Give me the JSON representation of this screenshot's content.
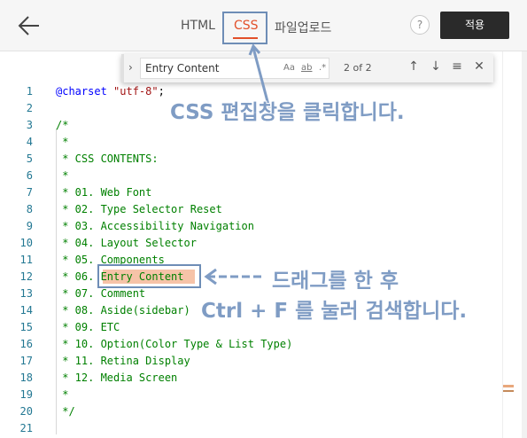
{
  "header": {
    "tabs": [
      {
        "label": "HTML",
        "active": false
      },
      {
        "label": "CSS",
        "active": true
      },
      {
        "label": "파일업로드",
        "active": false
      }
    ],
    "help_label": "?",
    "apply_label": "적용"
  },
  "find": {
    "query": "Entry Content",
    "opt_case": "Aa",
    "opt_word": "ab",
    "opt_regex": ".*",
    "count": "2 of 2"
  },
  "code": {
    "lines": [
      {
        "num": "1",
        "text": "@charset \"utf-8\";"
      },
      {
        "num": "2",
        "text": ""
      },
      {
        "num": "3",
        "text": "/*"
      },
      {
        "num": "4",
        "text": " *"
      },
      {
        "num": "5",
        "text": " * CSS CONTENTS:"
      },
      {
        "num": "6",
        "text": " *"
      },
      {
        "num": "7",
        "text": " * 01. Web Font"
      },
      {
        "num": "8",
        "text": " * 02. Type Selector Reset"
      },
      {
        "num": "9",
        "text": " * 03. Accessibility Navigation"
      },
      {
        "num": "10",
        "text": " * 04. Layout Selector"
      },
      {
        "num": "11",
        "text": " * 05. Components"
      },
      {
        "num": "12",
        "text": " * 06. Entry Content"
      },
      {
        "num": "13",
        "text": " * 07. Comment"
      },
      {
        "num": "14",
        "text": " * 08. Aside(sidebar)"
      },
      {
        "num": "15",
        "text": " * 09. ETC"
      },
      {
        "num": "16",
        "text": " * 10. Option(Color Type & List Type)"
      },
      {
        "num": "17",
        "text": " * 11. Retina Display"
      },
      {
        "num": "18",
        "text": " * 12. Media Screen"
      },
      {
        "num": "19",
        "text": " *"
      },
      {
        "num": "20",
        "text": " */"
      },
      {
        "num": "21",
        "text": ""
      }
    ]
  },
  "annotations": {
    "click_css": "CSS 편집창을 클릭합니다.",
    "drag": "드래그를 한 후",
    "search": "Ctrl + F 를 눌러 검색합니다."
  },
  "colors": {
    "accent": "#e2502a",
    "callout": "#7f9cc4",
    "match_highlight": "#f6c3a8"
  }
}
